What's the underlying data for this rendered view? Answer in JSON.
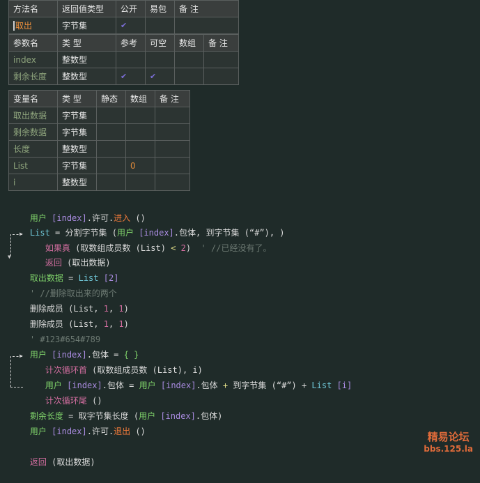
{
  "method_table": {
    "headers": [
      "方法名",
      "返回值类型",
      "公开",
      "易包",
      "备 注"
    ],
    "row": {
      "name": "取出",
      "type": "字节集",
      "public": "✔",
      "easy": "",
      "note": ""
    }
  },
  "param_table": {
    "headers": [
      "参数名",
      "类 型",
      "参考",
      "可空",
      "数组",
      "备 注"
    ],
    "rows": [
      {
        "name": "index",
        "type": "整数型",
        "ref": "",
        "opt": "",
        "arr": "",
        "note": ""
      },
      {
        "name": "剩余长度",
        "type": "整数型",
        "ref": "✔",
        "opt": "✔",
        "arr": "",
        "note": ""
      }
    ]
  },
  "var_table": {
    "headers": [
      "变量名",
      "类 型",
      "静态",
      "数组",
      "备 注"
    ],
    "rows": [
      {
        "name": "取出数据",
        "type": "字节集",
        "static": "",
        "arr": "",
        "note": ""
      },
      {
        "name": "剩余数据",
        "type": "字节集",
        "static": "",
        "arr": "",
        "note": ""
      },
      {
        "name": "长度",
        "type": "整数型",
        "static": "",
        "arr": "",
        "note": ""
      },
      {
        "name": "List",
        "type": "字节集",
        "static": "",
        "arr": "0",
        "note": ""
      },
      {
        "name": "i",
        "type": "整数型",
        "static": "",
        "arr": "",
        "note": ""
      }
    ]
  },
  "code": {
    "l1": [
      "用户",
      " [index]",
      ".许可.",
      "进入",
      " ()"
    ],
    "l2": [
      "List",
      " = ",
      "分割字节集",
      " (",
      "用户",
      " [index]",
      ".包体, ",
      "到字节集",
      " (“#”), )"
    ],
    "l3": [
      "如果真",
      " (",
      "取数组成员数",
      " (List) ",
      "<",
      " 2",
      ")",
      "  ' //已经没有了。"
    ],
    "l4": [
      "返回",
      " (取出数据)"
    ],
    "l5": [
      "取出数据",
      " = ",
      "List",
      " [2]"
    ],
    "l6": [
      "' //删除取出来的两个"
    ],
    "l7": [
      "删除成员",
      " (List, ",
      "1",
      ", ",
      "1",
      ")"
    ],
    "l8": [
      "删除成员",
      " (List, ",
      "1",
      ", ",
      "1",
      ")"
    ],
    "l9": [
      "' #123#654#789"
    ],
    "l10": [
      "用户",
      " [index]",
      ".包体",
      " = ",
      "{ }"
    ],
    "l11": [
      "计次循环首",
      " (",
      "取数组成员数",
      " (List), i)"
    ],
    "l12": [
      "用户",
      " [index]",
      ".包体",
      " = ",
      "用户",
      " [index]",
      ".包体",
      " + ",
      "到字节集",
      " (“#”) + ",
      "List",
      " [i]"
    ],
    "l13": [
      "计次循环尾",
      " ()"
    ],
    "l14": [
      "剩余长度",
      " = ",
      "取字节集长度",
      " (",
      "用户",
      " [index]",
      ".包体)"
    ],
    "l15": [
      "用户",
      " [index]",
      ".许可.",
      "退出",
      " ()"
    ],
    "l16": [
      "返回",
      " (取出数据)"
    ]
  },
  "watermark": {
    "line1": "精易论坛",
    "line2": "bbs.125.la"
  }
}
